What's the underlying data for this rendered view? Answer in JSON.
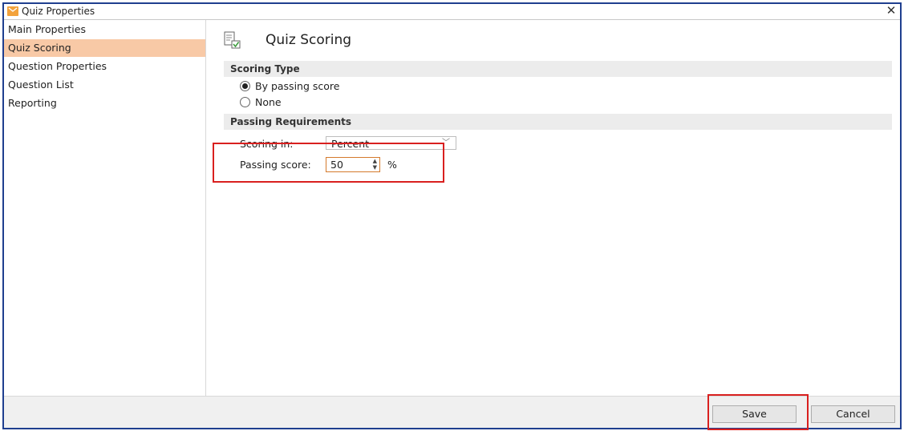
{
  "window": {
    "title": "Quiz Properties",
    "close_glyph": "✕"
  },
  "sidebar": {
    "items": [
      {
        "label": "Main Properties",
        "active": false
      },
      {
        "label": "Quiz Scoring",
        "active": true
      },
      {
        "label": "Question Properties",
        "active": false
      },
      {
        "label": "Question List",
        "active": false
      },
      {
        "label": "Reporting",
        "active": false
      }
    ]
  },
  "main": {
    "title": "Quiz Scoring",
    "scoring_type": {
      "header": "Scoring Type",
      "options": [
        {
          "label": "By passing score",
          "selected": true
        },
        {
          "label": "None",
          "selected": false
        }
      ]
    },
    "passing_requirements": {
      "header": "Passing Requirements",
      "scoring_in_label": "Scoring in:",
      "scoring_in_value": "Percent",
      "passing_score_label": "Passing score:",
      "passing_score_value": "50",
      "passing_score_unit": "%"
    }
  },
  "footer": {
    "save_label": "Save",
    "cancel_label": "Cancel"
  },
  "colors": {
    "accent": "#f3a23b",
    "active_nav": "#f8c9a6",
    "highlight_box": "#d9201f",
    "window_border": "#1f3f8f"
  }
}
